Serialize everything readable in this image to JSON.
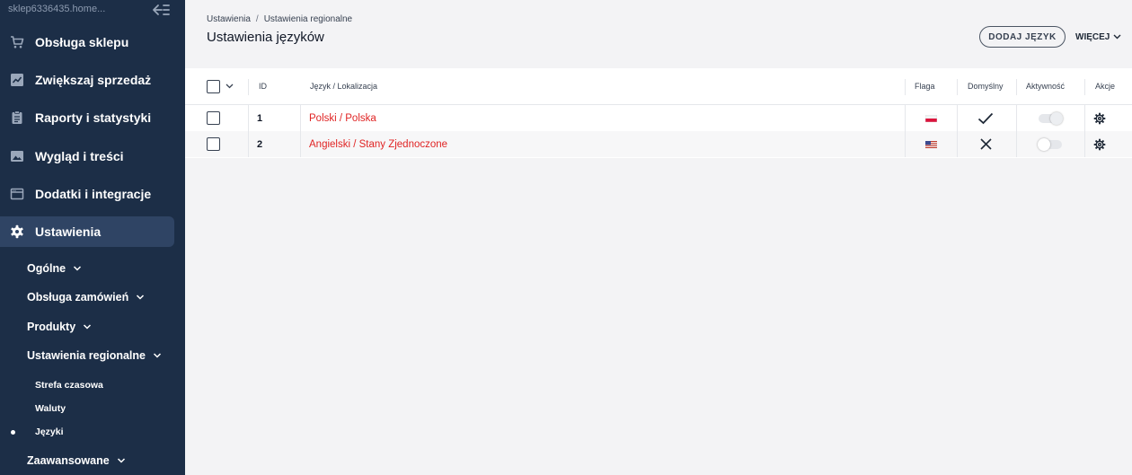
{
  "sidebar": {
    "shop_name": "sklep6336435.home...",
    "items": [
      {
        "label": "Obsługa sklepu"
      },
      {
        "label": "Zwiększaj sprzedaż"
      },
      {
        "label": "Raporty i statystyki"
      },
      {
        "label": "Wygląd i treści"
      },
      {
        "label": "Dodatki i integracje"
      },
      {
        "label": "Ustawienia"
      }
    ],
    "sub_items": [
      {
        "label": "Ogólne"
      },
      {
        "label": "Obsługa zamówień"
      },
      {
        "label": "Produkty"
      },
      {
        "label": "Ustawienia regionalne"
      },
      {
        "label": "Zaawansowane"
      }
    ],
    "regional_items": [
      {
        "label": "Strefa czasowa"
      },
      {
        "label": "Waluty"
      },
      {
        "label": "Języki"
      }
    ]
  },
  "header": {
    "breadcrumb": [
      "Ustawienia",
      "Ustawienia regionalne"
    ],
    "separator": "/",
    "title": "Ustawienia języków",
    "add_button": "DODAJ JĘZYK",
    "more_button": "WIĘCEJ"
  },
  "table": {
    "columns": {
      "id": "ID",
      "language": "Język / Lokalizacja",
      "flag": "Flaga",
      "default": "Domyślny",
      "active": "Aktywność",
      "actions": "Akcje"
    },
    "rows": [
      {
        "id": "1",
        "language": "Polski / Polska",
        "flag": "poland-flag-icon",
        "default": true,
        "active": true
      },
      {
        "id": "2",
        "language": "Angielski / Stany Zjednoczone",
        "flag": "usa-flag-icon",
        "default": false,
        "active": false
      }
    ]
  },
  "colors": {
    "sidebar_bg": "#1c2e47",
    "accent_link": "#e02424",
    "page_bg": "#f3f3f5"
  }
}
